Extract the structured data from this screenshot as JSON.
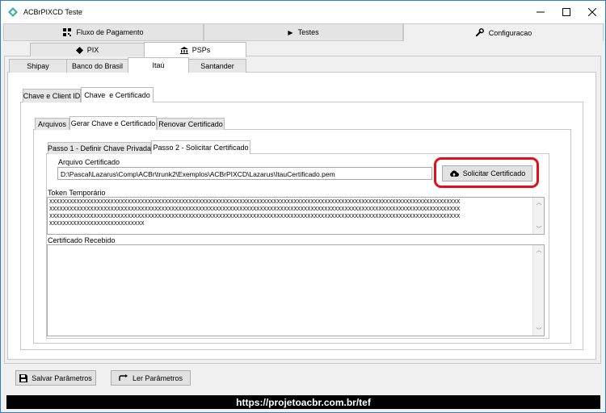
{
  "window": {
    "title": "ACBrPIXCD Teste"
  },
  "main_tabs": [
    {
      "label": "Fluxo de Pagamento",
      "icon": "qrcode-icon"
    },
    {
      "label": "Testes",
      "icon": "play-icon"
    },
    {
      "label": "Configuracao",
      "icon": "wrench-icon"
    }
  ],
  "config_tabs": [
    {
      "label": "PIX",
      "icon": "diamond-icon"
    },
    {
      "label": "PSPs",
      "icon": "bank-icon"
    }
  ],
  "psp_tabs": [
    "Shipay",
    "Banco do Brasil",
    "Itaú",
    "Santander"
  ],
  "itau_tabs": [
    "Chave e Client ID",
    "Chave  e Certificado"
  ],
  "cert_tabs": [
    "Arquivos",
    "Gerar Chave e Certificado",
    "Renovar Certificado"
  ],
  "step_tabs": [
    "Passo 1 - Definir Chave Privada",
    "Passo 2 - Solicitar Certificado"
  ],
  "arquivo_certificado": {
    "label": "Arquivo Certificado",
    "value": "D:\\Pascal\\Lazarus\\Comp\\ACBr\\trunk2\\Exemplos\\ACBrPIXCD\\Lazarus\\ItauCertificado.pem"
  },
  "solicitar_button": "Solicitar Certificado",
  "token": {
    "label": "Token Temporário",
    "value": "XXXXXXXXXXXXXXXXXXXXXXXXXXXXXXXXXXXXXXXXXXXXXXXXXXXXXXXXXXXXXXXXXXXXXXXXXXXXXXXXXXXXXXXXXXXXXXXXXXXXXXXXXXXXXXXXXXXXXXXXX\nXXXXXXXXXXXXXXXXXXXXXXXXXXXXXXXXXXXXXXXXXXXXXXXXXXXXXXXXXXXXXXXXXXXXXXXXXXXXXXXXXXXXXXXXXXXXXXXXXXXXXXXXXXXXXXXXXXXXXXXXX\nXXXXXXXXXXXXXXXXXXXXXXXXXXXXXXXXXXXXXXXXXXXXXXXXXXXXXXXXXXXXXXXXXXXXXXXXXXXXXXXXXXXXXXXXXXXXXXXXXXXXXXXXXXXXXXXXXXXXXXXXX\nXXXXXXXXXXXXXXXXXXXXXXXXXXXX"
  },
  "certificado_recebido": {
    "label": "Certificado Recebido",
    "value": ""
  },
  "bottom_buttons": {
    "salvar": "Salvar Parâmetros",
    "ler": "Ler Parâmetros"
  },
  "footer": "https://projetoacbr.com.br/tef",
  "colors": {
    "highlight": "#e0101a",
    "title_icon": "#3fb0a8"
  }
}
